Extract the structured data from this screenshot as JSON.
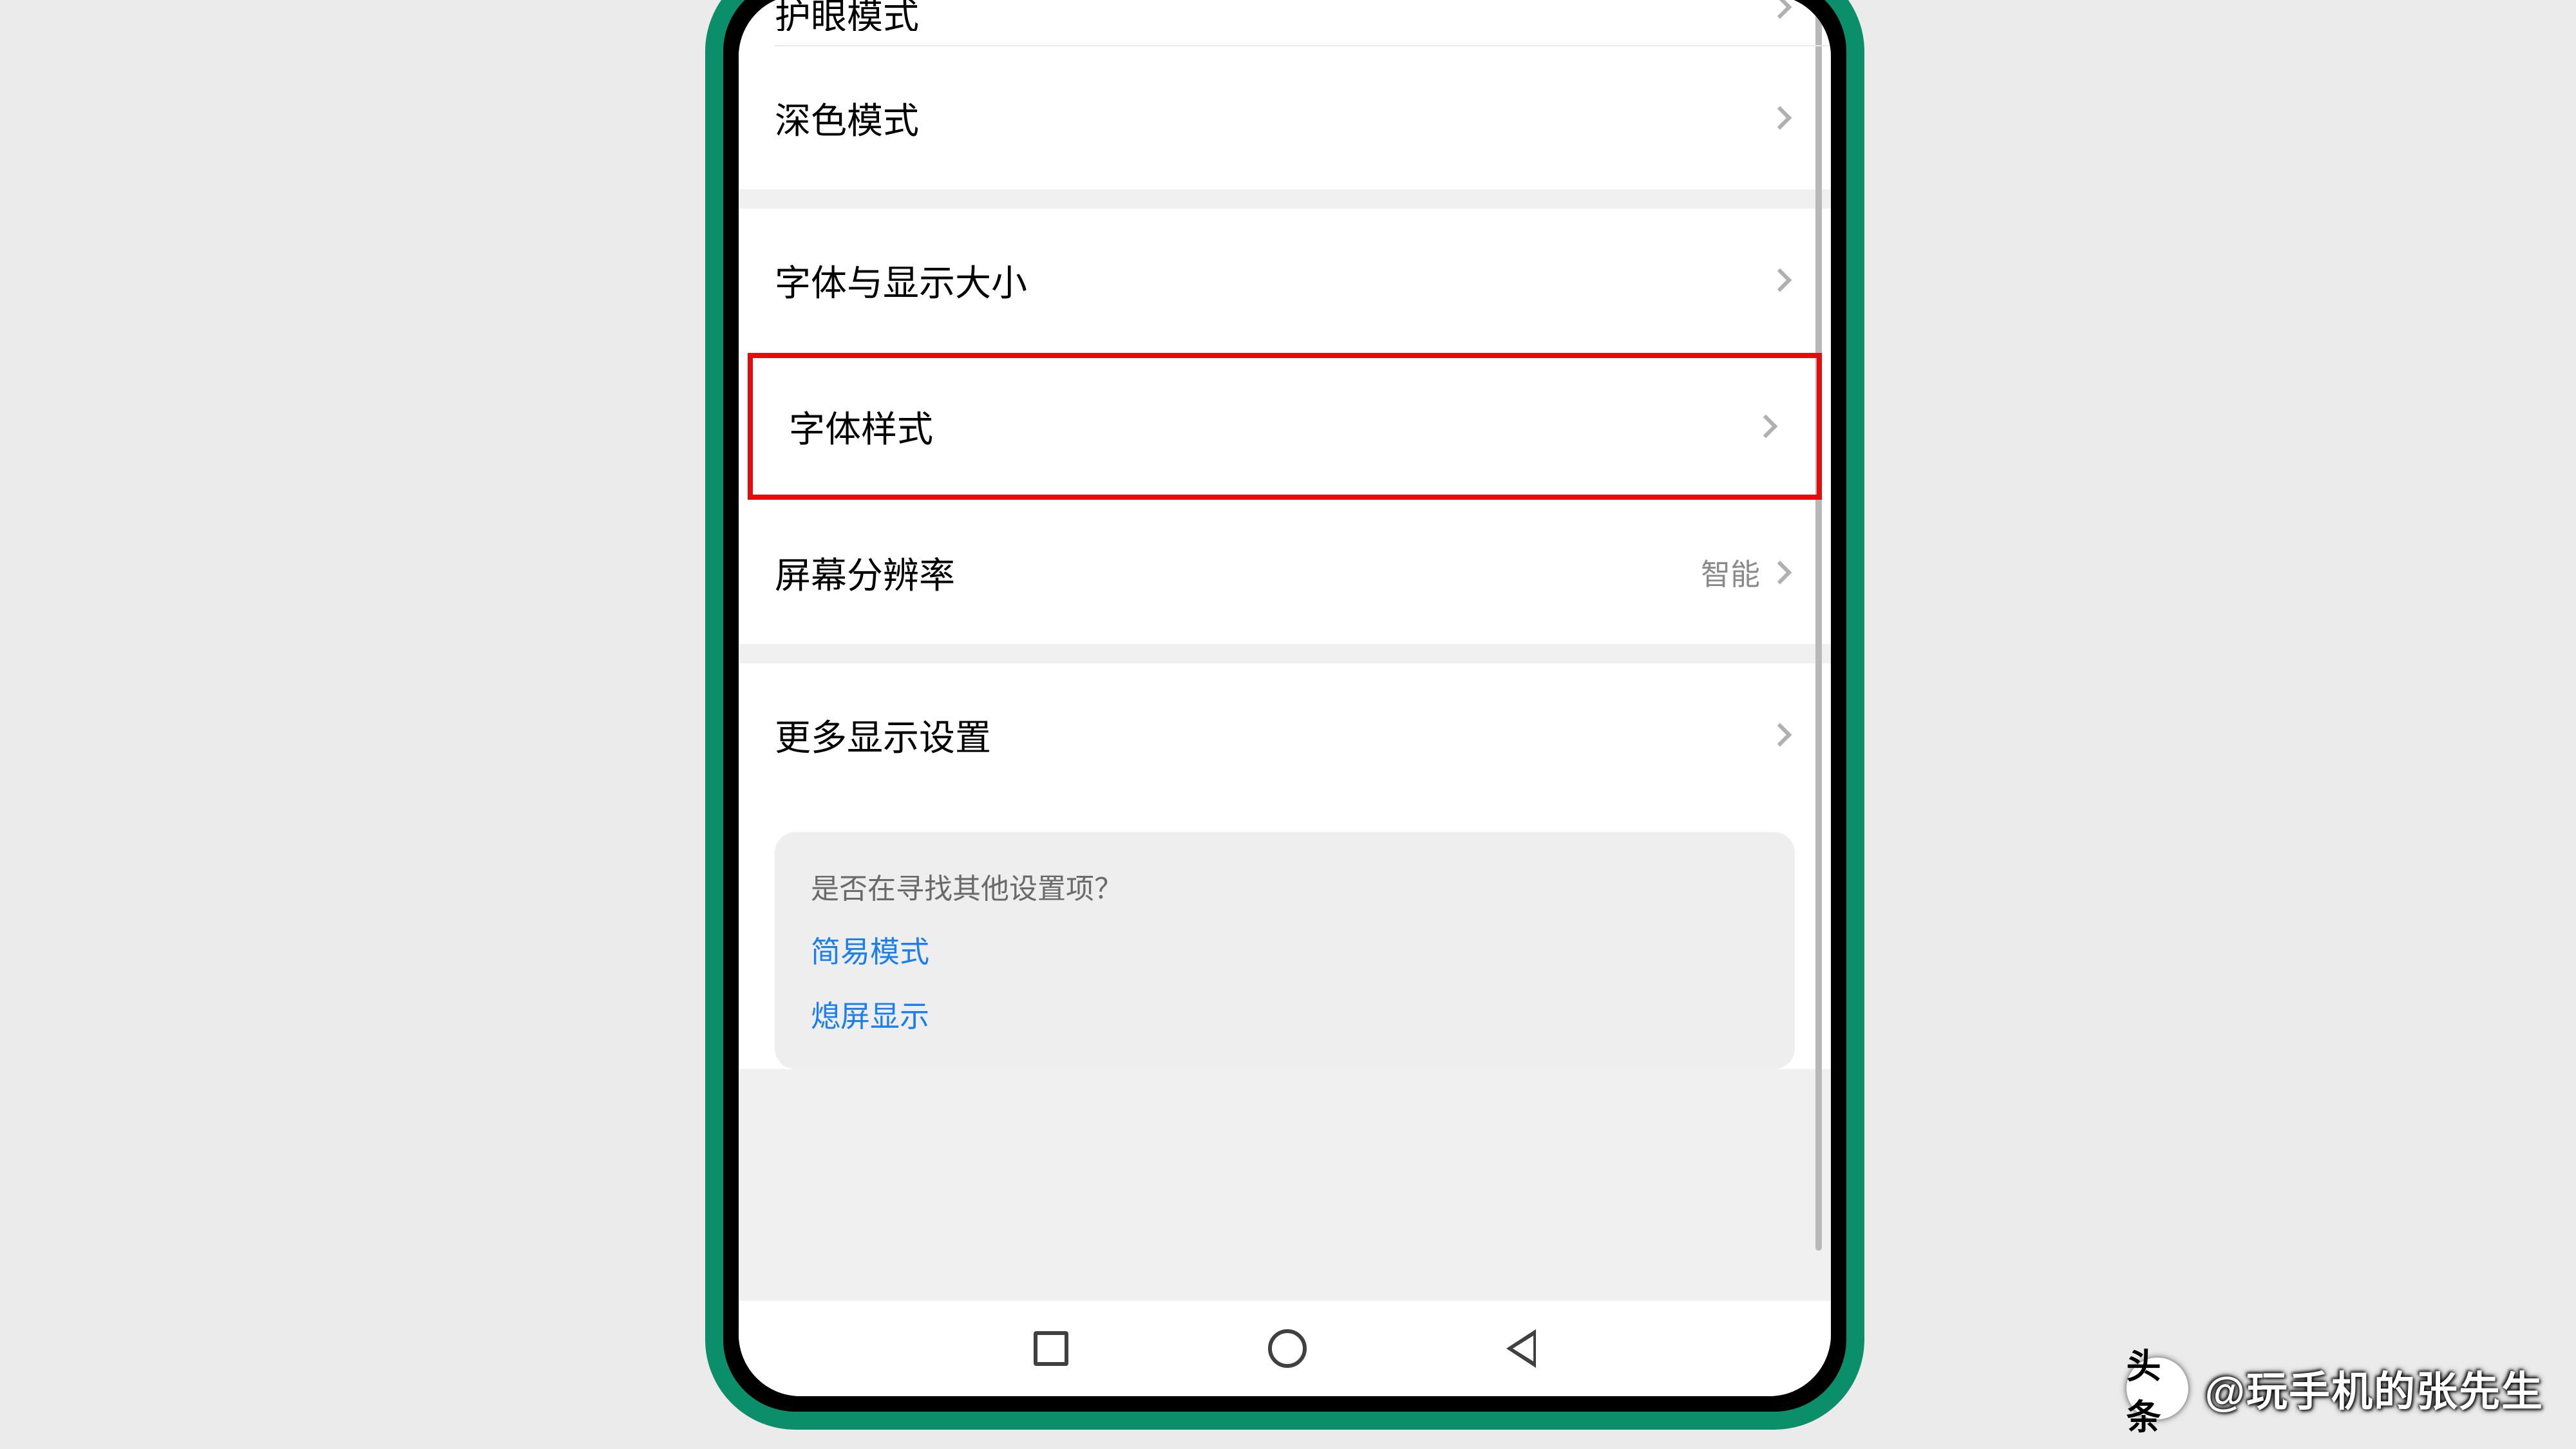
{
  "settings": {
    "group1": {
      "eye_protection": "护眼模式",
      "dark_mode": "深色模式"
    },
    "group2": {
      "font_display_size": "字体与显示大小",
      "font_style": "字体样式",
      "screen_resolution": {
        "label": "屏幕分辨率",
        "value": "智能"
      }
    },
    "group3": {
      "more_display": "更多显示设置"
    }
  },
  "suggestions": {
    "title": "是否在寻找其他设置项？",
    "links": [
      "简易模式",
      "熄屏显示"
    ]
  },
  "watermark": {
    "logo_text": "头条",
    "text": "@玩手机的张先生"
  }
}
